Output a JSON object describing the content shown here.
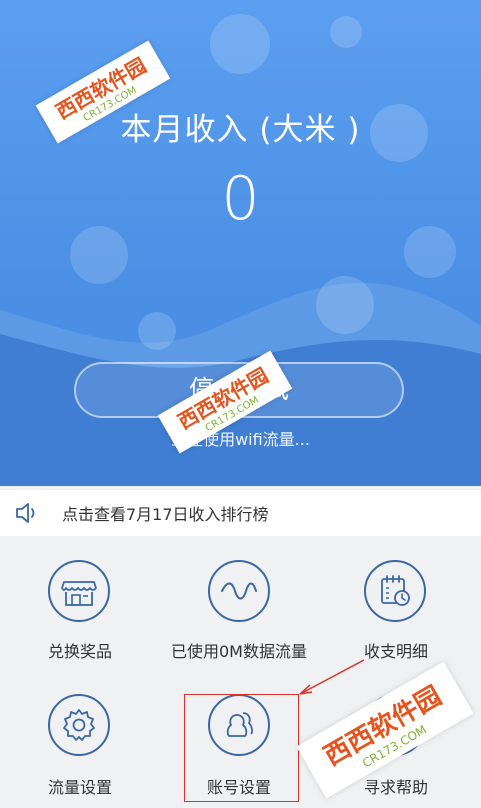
{
  "hero": {
    "title": "本月收入 (大米 )",
    "value": "0",
    "button_label": "停止测试",
    "hint": "正在使用wifi流量..."
  },
  "notice": {
    "text": "点击查看7月17日收入排行榜",
    "icon": "speaker-icon"
  },
  "grid": {
    "exchange": "兑换奖品",
    "usage": "已使用0M数据流量",
    "ledger": "收支明细",
    "flow_settings": "流量设置",
    "account_settings": "账号设置",
    "help": "寻求帮助"
  },
  "watermark": {
    "brand": "西西软件园",
    "site": "CR173.COM"
  },
  "colors": {
    "primary": "#4a8fe4",
    "icon_stroke": "#3a67a5",
    "annotation": "#d8332a"
  }
}
